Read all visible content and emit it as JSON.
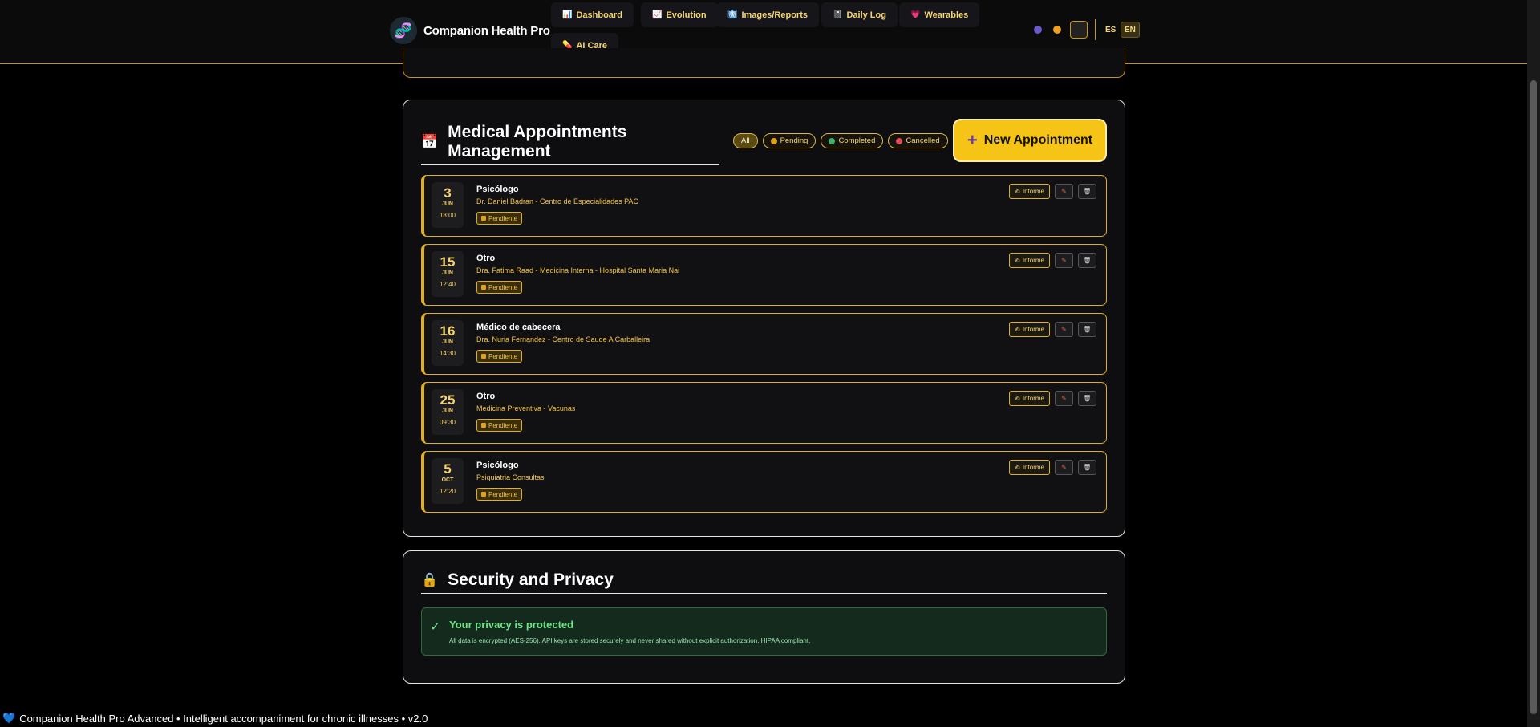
{
  "header": {
    "brand": "Companion Health Pro",
    "nav": [
      {
        "label": "Dashboard",
        "icon": "📊"
      },
      {
        "label": "Evolution",
        "icon": "📈"
      },
      {
        "label": "Images/Reports",
        "icon": "🩻"
      },
      {
        "label": "Daily Log",
        "icon": "📓"
      },
      {
        "label": "Wearables",
        "icon": "💗"
      },
      {
        "label": "AI Care",
        "icon": "💊"
      }
    ],
    "languages": [
      "ES",
      "EN"
    ],
    "active_language": "EN"
  },
  "appointments": {
    "title": "Medical Appointments Management",
    "filters": [
      {
        "label": "All"
      },
      {
        "label": "Pending",
        "color": "#e0a020"
      },
      {
        "label": "Completed",
        "color": "#3ab26a"
      },
      {
        "label": "Cancelled",
        "color": "#e04a5a"
      }
    ],
    "new_button": "New Appointment",
    "items": [
      {
        "day": "3",
        "month": "JUN",
        "time": "18:00",
        "title": "Psicólogo",
        "subtitle": "Dr. Daniel Badran - Centro de Especialidades PAC",
        "status": "Pendiente"
      },
      {
        "day": "15",
        "month": "JUN",
        "time": "12:40",
        "title": "Otro",
        "subtitle": "Dra. Fatima Raad - Medicina Interna - Hospital Santa Maria Nai",
        "status": "Pendiente"
      },
      {
        "day": "16",
        "month": "JUN",
        "time": "14:30",
        "title": "Médico de cabecera",
        "subtitle": "Dra. Nuria Fernandez - Centro de Saude A Carballeira",
        "status": "Pendiente"
      },
      {
        "day": "25",
        "month": "JUN",
        "time": "09:30",
        "title": "Otro",
        "subtitle": "Medicina Preventiva - Vacunas",
        "status": "Pendiente"
      },
      {
        "day": "5",
        "month": "OCT",
        "time": "12:20",
        "title": "Psicólogo",
        "subtitle": "Psiquiatria Consultas",
        "status": "Pendiente"
      }
    ],
    "action_label": "Informe"
  },
  "security": {
    "title": "Security and Privacy",
    "privacy_title": "Your privacy is protected",
    "privacy_text": "All data is encrypted (AES-256). API keys are stored securely and never shared without explicit authorization. HIPAA compliant."
  },
  "footer": {
    "text": "Companion Health Pro Advanced • Intelligent accompaniment for chronic illnesses • v2.0"
  }
}
